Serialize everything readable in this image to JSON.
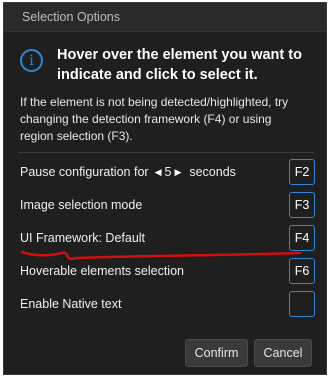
{
  "dialog": {
    "title": "Selection Options",
    "info_icon": "info-circle-icon",
    "heading_line1": "Hover over the element you want to",
    "heading_line2": "indicate and click to select it.",
    "note_line1": "If the element is not being detected/highlighted, try",
    "note_line2": "changing the detection framework (F4) or using",
    "note_line3": "region selection (F3).",
    "options": [
      {
        "label": "Pause configuration for",
        "value": "5",
        "suffix": "seconds",
        "hotkey": "F2"
      },
      {
        "label": "Image selection mode",
        "hotkey": "F3"
      },
      {
        "label": "UI Framework: Default",
        "hotkey": "F4"
      },
      {
        "label": "Hoverable elements selection",
        "hotkey": "F6"
      },
      {
        "label": "Enable Native text",
        "hotkey": ""
      }
    ],
    "confirm_label": "Confirm",
    "cancel_label": "Cancel",
    "accent_color": "#2f86d8",
    "annotation_color": "#d01010"
  }
}
